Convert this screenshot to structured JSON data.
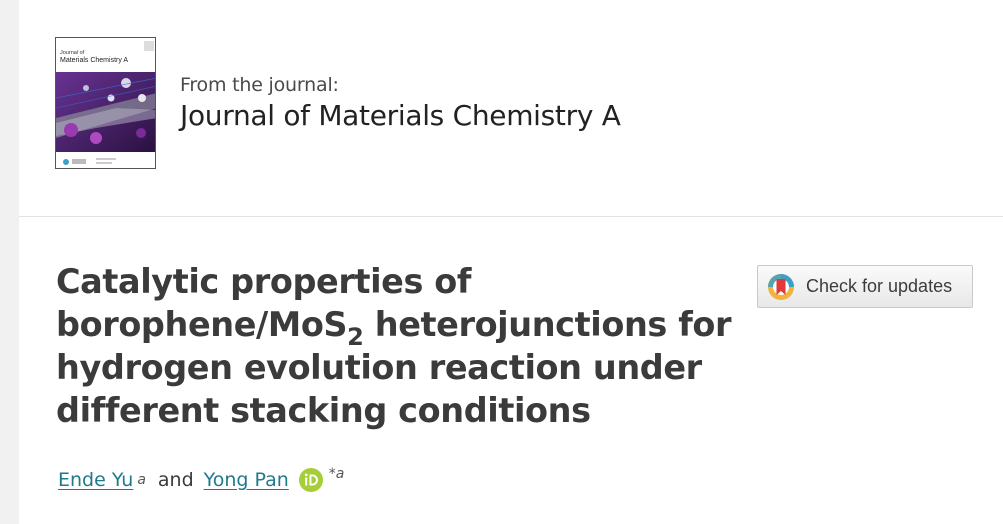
{
  "journal": {
    "from_label": "From the journal:",
    "name": "Journal of Materials Chemistry A",
    "cover_title_line1": "Journal of",
    "cover_title_line2": "Materials Chemistry A"
  },
  "article": {
    "title_part1": "Catalytic properties of borophene/MoS",
    "title_sub": "2",
    "title_part2": " heterojunctions for hydrogen evolution reaction under different stacking conditions"
  },
  "check_updates": {
    "label": "Check for updates"
  },
  "authors": [
    {
      "name": "Ende Yu",
      "affiliation": "a"
    },
    {
      "name": "Yong Pan",
      "affiliation": "*a"
    }
  ],
  "authors_joiner": "and",
  "colors": {
    "link": "#1e7a8c",
    "orcid": "#a6ce39",
    "cover_purple": "#5b2a7a"
  },
  "icons": [
    "journal-cover-image",
    "check-for-updates-icon",
    "orcid-icon"
  ]
}
